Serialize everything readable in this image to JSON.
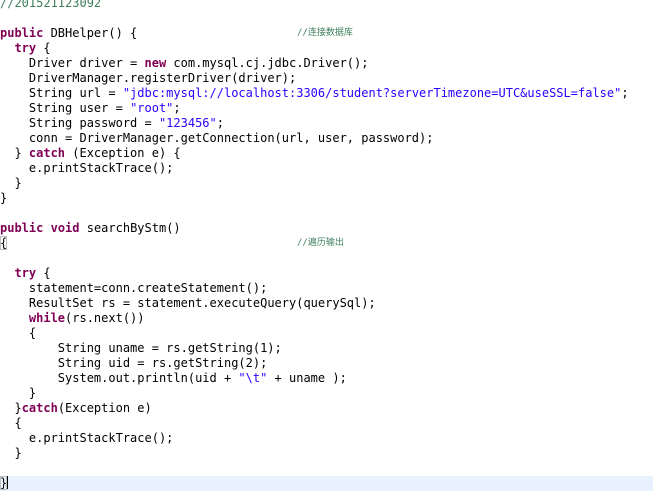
{
  "editor": {
    "top_comment": "//201521123092",
    "constructor": {
      "keyword_public": "public",
      "signature": " DBHelper() {",
      "comment": "//连接数据库",
      "try_kw": "try",
      "try_rest": " {",
      "driver_pre": "Driver driver = ",
      "driver_new": "new",
      "driver_post": " com.mysql.cj.jdbc.Driver();",
      "register": "DriverManager.registerDriver(driver);",
      "url_pre": "String url = ",
      "url_str": "\"jdbc:mysql://localhost:3306/student?serverTimezone=UTC&useSSL=false\"",
      "url_post": ";",
      "user_pre": "String user = ",
      "user_str": "\"root\"",
      "user_post": ";",
      "pw_pre": "String password = ",
      "pw_str": "\"123456\"",
      "pw_post": ";",
      "conn": "conn = DriverManager.getConnection(url, user, password);",
      "catch_pre": "} ",
      "catch_kw": "catch",
      "catch_post": " (Exception e) {",
      "print_trace": "e.printStackTrace();",
      "inner_close": "}",
      "outer_close": "}"
    },
    "method": {
      "kw_public": "public",
      "kw_void": "void",
      "name": " searchByStm()",
      "open_brace": "{",
      "comment": "//遍历输出",
      "try_kw": "try",
      "try_rest": " {",
      "statement": "statement=conn.createStatement();",
      "resultset": "ResultSet rs = statement.executeQuery(querySql);",
      "while_kw": "while",
      "while_rest": "(rs.next())",
      "while_open": "{",
      "uname": "String uname = rs.getString(1);",
      "uid": "String uid = rs.getString(2);",
      "println_pre": "System.out.println(uid + ",
      "println_str": "\"\\t\"",
      "println_post": " + uname );",
      "while_close": "}",
      "catch_pre": "}",
      "catch_kw": "catch",
      "catch_post": "(Exception e)",
      "catch_open": "{",
      "print_trace": "e.printStackTrace();",
      "catch_close": "}",
      "final_close": "}"
    }
  },
  "colors": {
    "keyword": "#7f0055",
    "string": "#2a00ff",
    "comment": "#3f7f5f",
    "current_line": "#e8f2fe"
  }
}
